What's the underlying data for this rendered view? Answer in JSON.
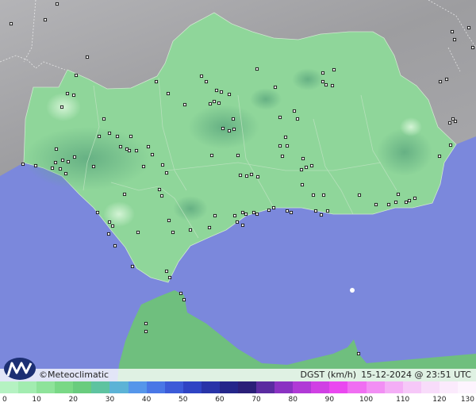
{
  "brand": {
    "copyright_symbol": "©",
    "name": "Meteoclimatic",
    "logo_icon": "meteoclimatic-m-logo-icon"
  },
  "info": {
    "variable": "DGST (km/h)",
    "datetime": "15-12-2024 @ 23:51 UTC"
  },
  "legend": {
    "min": 0,
    "max": 130,
    "ticks": [
      "0",
      "10",
      "20",
      "30",
      "40",
      "50",
      "60",
      "70",
      "80",
      "90",
      "100",
      "110",
      "120",
      "130"
    ],
    "colors": [
      "#b5f2c2",
      "#a2ecb0",
      "#8ee39a",
      "#79d886",
      "#69cc7e",
      "#5ec3a0",
      "#5cb3d6",
      "#5596ea",
      "#4977e6",
      "#3c5bd8",
      "#2f44c4",
      "#2834a8",
      "#24268a",
      "#2a1f78",
      "#5a2ca0",
      "#8a32c2",
      "#b03ad6",
      "#d040e4",
      "#ea48f0",
      "#f06ef2",
      "#f28ff4",
      "#f4aef6",
      "#f6c8f8",
      "#f8dcfa",
      "#fbeafc",
      "#fdf4fe"
    ]
  },
  "map": {
    "colors": {
      "sea": "#7b88dc",
      "land_outside": "#a3a3a6",
      "region": "#8fd69a",
      "region_dark": "#6ebc84",
      "africa": "#6fbf7e",
      "station": "#ffffff"
    }
  }
}
